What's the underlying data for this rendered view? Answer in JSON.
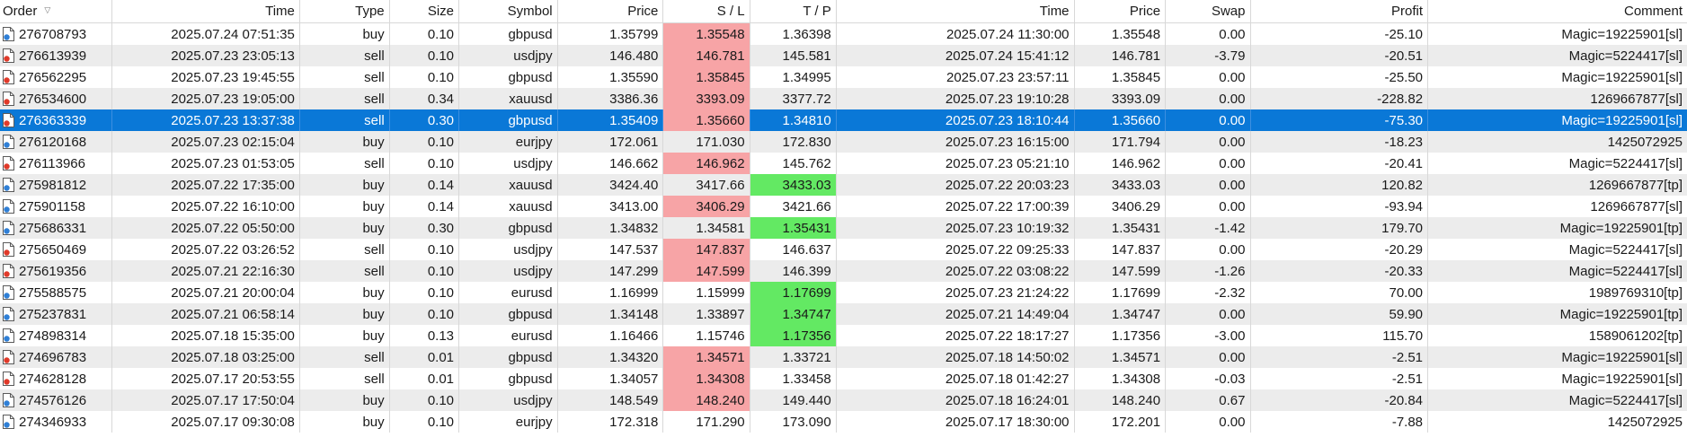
{
  "columns": {
    "order": "Order",
    "time": "Time",
    "type": "Type",
    "size": "Size",
    "symbol": "Symbol",
    "price": "Price",
    "sl": "S / L",
    "tp": "T / P",
    "close_time": "Time",
    "close_price": "Price",
    "swap": "Swap",
    "profit": "Profit",
    "comment": "Comment"
  },
  "sort_indicator": "▽",
  "selected_order": "276363339",
  "colors": {
    "selected_row": "#0a78d7",
    "sl_hit": "#f7a4a6",
    "tp_hit": "#63e963",
    "buy_icon": "#2f7fd6",
    "sell_icon": "#e03a2a",
    "alt_row": "#ececec"
  },
  "rows": [
    {
      "order": "276708793",
      "time": "2025.07.24 07:51:35",
      "type": "buy",
      "size": "0.10",
      "symbol": "gbpusd",
      "price": "1.35799",
      "sl": "1.35548",
      "tp": "1.36398",
      "close_time": "2025.07.24 11:30:00",
      "close_price": "1.35548",
      "swap": "0.00",
      "profit": "-25.10",
      "comment": "Magic=19225901[sl]",
      "hit": "sl"
    },
    {
      "order": "276613939",
      "time": "2025.07.23 23:05:13",
      "type": "sell",
      "size": "0.10",
      "symbol": "usdjpy",
      "price": "146.480",
      "sl": "146.781",
      "tp": "145.581",
      "close_time": "2025.07.24 15:41:12",
      "close_price": "146.781",
      "swap": "-3.79",
      "profit": "-20.51",
      "comment": "Magic=5224417[sl]",
      "hit": "sl"
    },
    {
      "order": "276562295",
      "time": "2025.07.23 19:45:55",
      "type": "sell",
      "size": "0.10",
      "symbol": "gbpusd",
      "price": "1.35590",
      "sl": "1.35845",
      "tp": "1.34995",
      "close_time": "2025.07.23 23:57:11",
      "close_price": "1.35845",
      "swap": "0.00",
      "profit": "-25.50",
      "comment": "Magic=19225901[sl]",
      "hit": "sl"
    },
    {
      "order": "276534600",
      "time": "2025.07.23 19:05:00",
      "type": "sell",
      "size": "0.34",
      "symbol": "xauusd",
      "price": "3386.36",
      "sl": "3393.09",
      "tp": "3377.72",
      "close_time": "2025.07.23 19:10:28",
      "close_price": "3393.09",
      "swap": "0.00",
      "profit": "-228.82",
      "comment": "1269667877[sl]",
      "hit": "sl"
    },
    {
      "order": "276363339",
      "time": "2025.07.23 13:37:38",
      "type": "sell",
      "size": "0.30",
      "symbol": "gbpusd",
      "price": "1.35409",
      "sl": "1.35660",
      "tp": "1.34810",
      "close_time": "2025.07.23 18:10:44",
      "close_price": "1.35660",
      "swap": "0.00",
      "profit": "-75.30",
      "comment": "Magic=19225901[sl]",
      "hit": "sl"
    },
    {
      "order": "276120168",
      "time": "2025.07.23 02:15:04",
      "type": "buy",
      "size": "0.10",
      "symbol": "eurjpy",
      "price": "172.061",
      "sl": "171.030",
      "tp": "172.830",
      "close_time": "2025.07.23 16:15:00",
      "close_price": "171.794",
      "swap": "0.00",
      "profit": "-18.23",
      "comment": "1425072925",
      "hit": ""
    },
    {
      "order": "276113966",
      "time": "2025.07.23 01:53:05",
      "type": "sell",
      "size": "0.10",
      "symbol": "usdjpy",
      "price": "146.662",
      "sl": "146.962",
      "tp": "145.762",
      "close_time": "2025.07.23 05:21:10",
      "close_price": "146.962",
      "swap": "0.00",
      "profit": "-20.41",
      "comment": "Magic=5224417[sl]",
      "hit": "sl"
    },
    {
      "order": "275981812",
      "time": "2025.07.22 17:35:00",
      "type": "buy",
      "size": "0.14",
      "symbol": "xauusd",
      "price": "3424.40",
      "sl": "3417.66",
      "tp": "3433.03",
      "close_time": "2025.07.22 20:03:23",
      "close_price": "3433.03",
      "swap": "0.00",
      "profit": "120.82",
      "comment": "1269667877[tp]",
      "hit": "tp"
    },
    {
      "order": "275901158",
      "time": "2025.07.22 16:10:00",
      "type": "buy",
      "size": "0.14",
      "symbol": "xauusd",
      "price": "3413.00",
      "sl": "3406.29",
      "tp": "3421.66",
      "close_time": "2025.07.22 17:00:39",
      "close_price": "3406.29",
      "swap": "0.00",
      "profit": "-93.94",
      "comment": "1269667877[sl]",
      "hit": "sl"
    },
    {
      "order": "275686331",
      "time": "2025.07.22 05:50:00",
      "type": "buy",
      "size": "0.30",
      "symbol": "gbpusd",
      "price": "1.34832",
      "sl": "1.34581",
      "tp": "1.35431",
      "close_time": "2025.07.23 10:19:32",
      "close_price": "1.35431",
      "swap": "-1.42",
      "profit": "179.70",
      "comment": "Magic=19225901[tp]",
      "hit": "tp"
    },
    {
      "order": "275650469",
      "time": "2025.07.22 03:26:52",
      "type": "sell",
      "size": "0.10",
      "symbol": "usdjpy",
      "price": "147.537",
      "sl": "147.837",
      "tp": "146.637",
      "close_time": "2025.07.22 09:25:33",
      "close_price": "147.837",
      "swap": "0.00",
      "profit": "-20.29",
      "comment": "Magic=5224417[sl]",
      "hit": "sl"
    },
    {
      "order": "275619356",
      "time": "2025.07.21 22:16:30",
      "type": "sell",
      "size": "0.10",
      "symbol": "usdjpy",
      "price": "147.299",
      "sl": "147.599",
      "tp": "146.399",
      "close_time": "2025.07.22 03:08:22",
      "close_price": "147.599",
      "swap": "-1.26",
      "profit": "-20.33",
      "comment": "Magic=5224417[sl]",
      "hit": "sl"
    },
    {
      "order": "275588575",
      "time": "2025.07.21 20:00:04",
      "type": "buy",
      "size": "0.10",
      "symbol": "eurusd",
      "price": "1.16999",
      "sl": "1.15999",
      "tp": "1.17699",
      "close_time": "2025.07.23 21:24:22",
      "close_price": "1.17699",
      "swap": "-2.32",
      "profit": "70.00",
      "comment": "1989769310[tp]",
      "hit": "tp"
    },
    {
      "order": "275237831",
      "time": "2025.07.21 06:58:14",
      "type": "buy",
      "size": "0.10",
      "symbol": "gbpusd",
      "price": "1.34148",
      "sl": "1.33897",
      "tp": "1.34747",
      "close_time": "2025.07.21 14:49:04",
      "close_price": "1.34747",
      "swap": "0.00",
      "profit": "59.90",
      "comment": "Magic=19225901[tp]",
      "hit": "tp"
    },
    {
      "order": "274898314",
      "time": "2025.07.18 15:35:00",
      "type": "buy",
      "size": "0.13",
      "symbol": "eurusd",
      "price": "1.16466",
      "sl": "1.15746",
      "tp": "1.17356",
      "close_time": "2025.07.22 18:17:27",
      "close_price": "1.17356",
      "swap": "-3.00",
      "profit": "115.70",
      "comment": "1589061202[tp]",
      "hit": "tp"
    },
    {
      "order": "274696783",
      "time": "2025.07.18 03:25:00",
      "type": "sell",
      "size": "0.01",
      "symbol": "gbpusd",
      "price": "1.34320",
      "sl": "1.34571",
      "tp": "1.33721",
      "close_time": "2025.07.18 14:50:02",
      "close_price": "1.34571",
      "swap": "0.00",
      "profit": "-2.51",
      "comment": "Magic=19225901[sl]",
      "hit": "sl"
    },
    {
      "order": "274628128",
      "time": "2025.07.17 20:53:55",
      "type": "sell",
      "size": "0.01",
      "symbol": "gbpusd",
      "price": "1.34057",
      "sl": "1.34308",
      "tp": "1.33458",
      "close_time": "2025.07.18 01:42:27",
      "close_price": "1.34308",
      "swap": "-0.03",
      "profit": "-2.51",
      "comment": "Magic=19225901[sl]",
      "hit": "sl"
    },
    {
      "order": "274576126",
      "time": "2025.07.17 17:50:04",
      "type": "buy",
      "size": "0.10",
      "symbol": "usdjpy",
      "price": "148.549",
      "sl": "148.240",
      "tp": "149.440",
      "close_time": "2025.07.18 16:24:01",
      "close_price": "148.240",
      "swap": "0.67",
      "profit": "-20.84",
      "comment": "Magic=5224417[sl]",
      "hit": "sl"
    },
    {
      "order": "274346933",
      "time": "2025.07.17 09:30:08",
      "type": "buy",
      "size": "0.10",
      "symbol": "eurjpy",
      "price": "172.318",
      "sl": "171.290",
      "tp": "173.090",
      "close_time": "2025.07.17 18:30:00",
      "close_price": "172.201",
      "swap": "0.00",
      "profit": "-7.88",
      "comment": "1425072925",
      "hit": ""
    }
  ]
}
